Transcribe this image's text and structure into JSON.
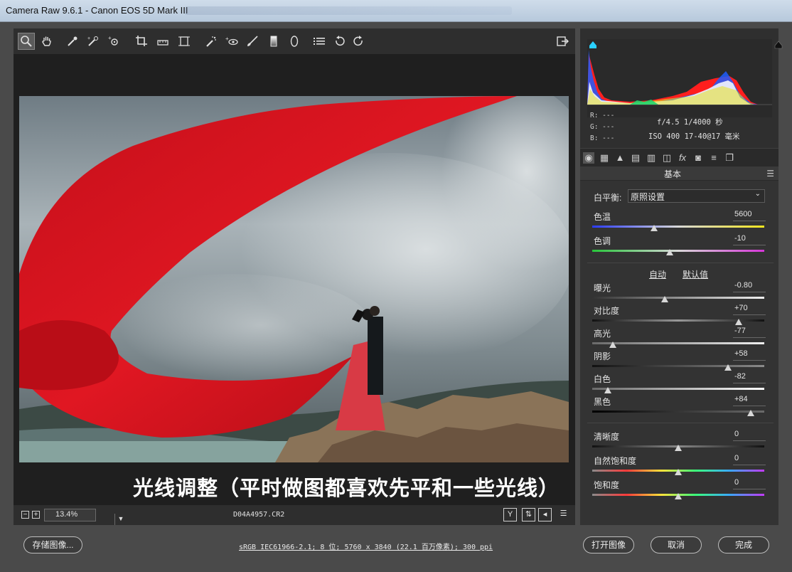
{
  "window": {
    "title": "Camera Raw 9.6.1 -  Canon EOS 5D Mark III"
  },
  "toolbar": {
    "tools": [
      "zoom-tool",
      "hand-tool",
      "white-balance-tool",
      "color-sampler-tool",
      "targeted-adjustment-tool",
      "crop-tool",
      "straighten-tool",
      "transform-tool",
      "spot-removal-tool",
      "red-eye-tool",
      "adjustment-brush",
      "graduated-filter",
      "radial-filter",
      "preferences",
      "rotate-ccw",
      "rotate-cw"
    ],
    "active_tool": "zoom-tool"
  },
  "preview": {
    "caption": "光线调整（平时做图都喜欢先平和一些光线）",
    "zoom_value": "13.4%",
    "filename": "D04A4957.CR2"
  },
  "histogram": {
    "r": "R:  ---",
    "g": "G:  ---",
    "b": "B:  ---",
    "exif_line1": "f/4.5   1/4000 秒",
    "exif_line2": "ISO 400   17-40@17 毫米"
  },
  "panel": {
    "title": "基本",
    "wb_label": "白平衡:",
    "wb_value": "原照设置",
    "auto_label": "自动",
    "default_label": "默认值",
    "sliders": [
      {
        "key": "temp",
        "label": "色温",
        "value": "5600",
        "pos": 0.36
      },
      {
        "key": "tint",
        "label": "色调",
        "value": "-10",
        "pos": 0.45
      },
      {
        "key": "exposure",
        "label": "曝光",
        "value": "-0.80",
        "pos": 0.42
      },
      {
        "key": "contrast",
        "label": "对比度",
        "value": "+70",
        "pos": 0.85
      },
      {
        "key": "highlights",
        "label": "高光",
        "value": "-77",
        "pos": 0.12
      },
      {
        "key": "shadows",
        "label": "阴影",
        "value": "+58",
        "pos": 0.79
      },
      {
        "key": "whites",
        "label": "白色",
        "value": "-82",
        "pos": 0.09
      },
      {
        "key": "blacks",
        "label": "黑色",
        "value": "+84",
        "pos": 0.92
      },
      {
        "key": "clarity",
        "label": "清晰度",
        "value": "0",
        "pos": 0.5
      },
      {
        "key": "vibrance",
        "label": "自然饱和度",
        "value": "0",
        "pos": 0.5
      },
      {
        "key": "saturation",
        "label": "饱和度",
        "value": "0",
        "pos": 0.5
      }
    ]
  },
  "bottom": {
    "save_label": "存储图像...",
    "info": "sRGB IEC61966-2.1; 8 位; 5760 x 3840 (22.1 百万像素); 300 ppi",
    "open_label": "打开图像",
    "cancel_label": "取消",
    "done_label": "完成"
  },
  "colors": {
    "accent_clip": "#2ad0ff",
    "cloth_red": "#d8111c"
  }
}
